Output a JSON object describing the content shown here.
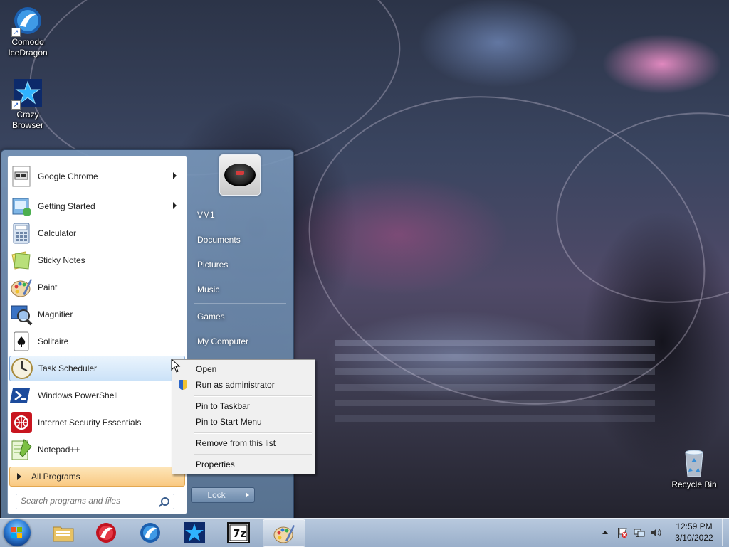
{
  "desktop": {
    "icons": [
      {
        "label": "Comodo\nIceDragon",
        "icon": "icedragon-icon"
      },
      {
        "label": "Crazy Browser",
        "icon": "crazy-browser-icon"
      },
      {
        "label": "Recycle Bin",
        "icon": "recycle-bin-icon"
      }
    ]
  },
  "start_menu": {
    "programs": [
      {
        "label": "Google Chrome",
        "icon": "chrome-icon",
        "has_submenu": true
      },
      {
        "label": "Getting Started",
        "icon": "getting-started-icon",
        "has_submenu": true
      },
      {
        "label": "Calculator",
        "icon": "calculator-icon"
      },
      {
        "label": "Sticky Notes",
        "icon": "sticky-notes-icon"
      },
      {
        "label": "Paint",
        "icon": "paint-icon"
      },
      {
        "label": "Magnifier",
        "icon": "magnifier-icon"
      },
      {
        "label": "Solitaire",
        "icon": "solitaire-icon"
      },
      {
        "label": "Task Scheduler",
        "icon": "task-scheduler-icon",
        "selected": true
      },
      {
        "label": "Windows PowerShell",
        "icon": "powershell-icon"
      },
      {
        "label": "Internet Security Essentials",
        "icon": "internet-security-icon"
      },
      {
        "label": "Notepad++",
        "icon": "notepadpp-icon"
      }
    ],
    "all_programs": "All Programs",
    "search_placeholder": "Search programs and files",
    "right_items": [
      "VM1",
      "Documents",
      "Pictures",
      "Music",
      "Games",
      "My Computer"
    ],
    "lock_label": "Lock"
  },
  "context_menu": {
    "items": [
      "Open",
      "Run as administrator",
      "Pin to Taskbar",
      "Pin to Start Menu",
      "Remove from this list",
      "Properties"
    ]
  },
  "taskbar": {
    "pinned": [
      "explorer-icon",
      "icedragon-icon",
      "comodo-dragon-icon",
      "crazy-browser-icon",
      "7zip-icon",
      "paint-icon"
    ],
    "seven_zip_label": "7z",
    "time": "12:59 PM",
    "date": "3/10/2022"
  },
  "colors": {
    "start_orb": "#2d7ed8",
    "selection": "#cbe2f8",
    "all_programs_highlight": "#f9c982"
  }
}
